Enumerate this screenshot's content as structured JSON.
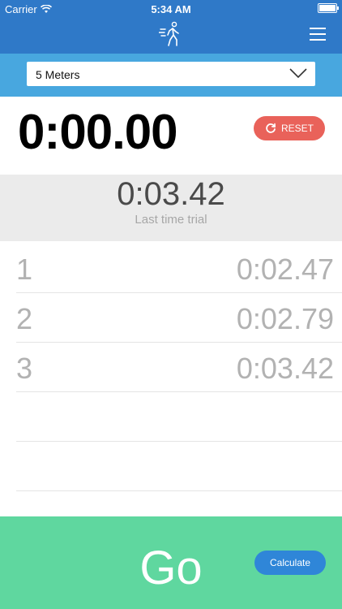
{
  "status_bar": {
    "carrier": "Carrier",
    "time": "5:34 AM",
    "wifi_icon": "wifi-icon",
    "battery_icon": "battery-icon"
  },
  "header": {
    "logo_icon": "walking-person-icon",
    "menu_icon": "hamburger-menu-icon",
    "brand_color": "#2f79c8"
  },
  "distance_select": {
    "value": "5 Meters",
    "icon": "chevron-down-icon",
    "bar_color": "#48a7df"
  },
  "timer": {
    "value": "0:00.00",
    "reset_label": "RESET",
    "reset_icon": "refresh-icon",
    "reset_color": "#e9625a"
  },
  "last_trial": {
    "time": "0:03.42",
    "label": "Last time trial"
  },
  "trials": [
    {
      "number": "1",
      "time": "0:02.47"
    },
    {
      "number": "2",
      "time": "0:02.79"
    },
    {
      "number": "3",
      "time": "0:03.42"
    }
  ],
  "footer": {
    "go_label": "Go",
    "calculate_label": "Calculate",
    "color": "#5fd79f",
    "calculate_color": "#2f86d8"
  }
}
